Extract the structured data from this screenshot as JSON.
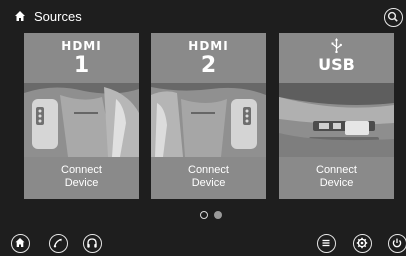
{
  "header": {
    "title": "Sources",
    "home_icon": "home-icon",
    "search_icon": "search-icon"
  },
  "cards": [
    {
      "brand": "HDMI",
      "number": "1",
      "action_line1": "Connect",
      "action_line2": "Device"
    },
    {
      "brand": "HDMI",
      "number": "2",
      "action_line1": "Connect",
      "action_line2": "Device"
    },
    {
      "brand": "USB",
      "number": "",
      "action_line1": "Connect",
      "action_line2": "Device",
      "icon": "usb-icon"
    }
  ],
  "pager": {
    "pages": 2,
    "current": 1
  },
  "bottombar": {
    "left": [
      "home-icon",
      "navigation-icon",
      "headphones-icon"
    ],
    "right": [
      "menu-icon",
      "settings-icon",
      "power-icon"
    ]
  },
  "colors": {
    "background": "#1e1e1e",
    "card": "#8a8a8a",
    "text": "#ffffff"
  }
}
